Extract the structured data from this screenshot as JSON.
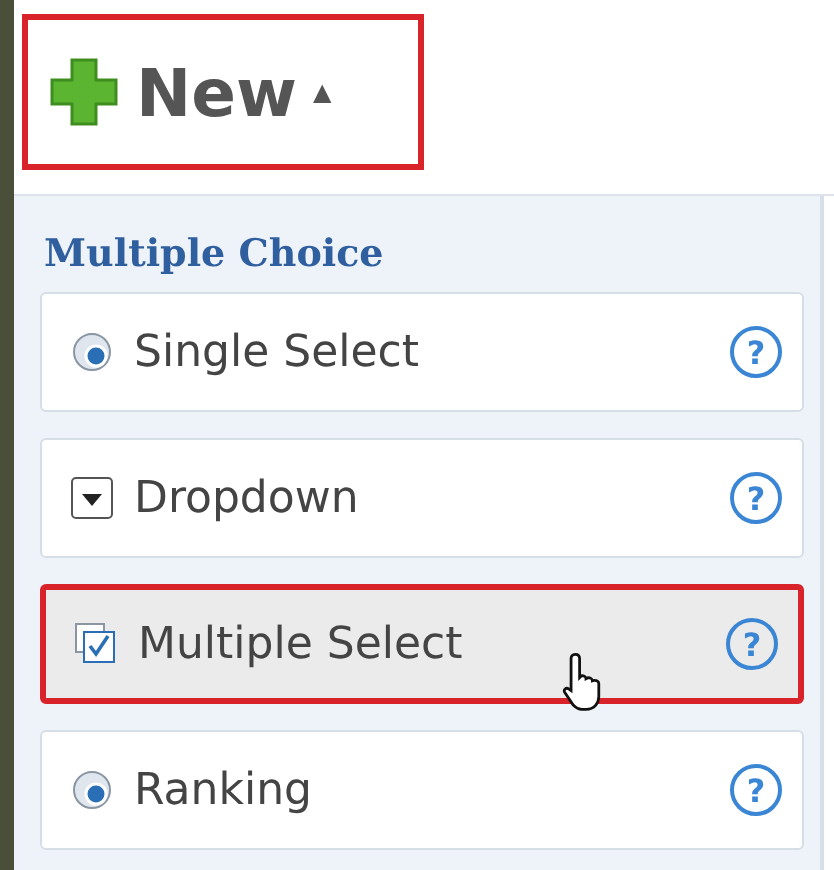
{
  "new_button": {
    "label": "New",
    "caret": "▲",
    "selected": true
  },
  "section": {
    "heading": "Multiple Choice"
  },
  "items": [
    {
      "kind": "radio",
      "label": "Single Select",
      "help": "?",
      "selected": false
    },
    {
      "kind": "dropdown",
      "label": "Dropdown",
      "help": "?",
      "selected": false
    },
    {
      "kind": "checkbox",
      "label": "Multiple Select",
      "help": "?",
      "selected": true
    },
    {
      "kind": "radio",
      "label": "Ranking",
      "help": "?",
      "selected": false
    }
  ]
}
